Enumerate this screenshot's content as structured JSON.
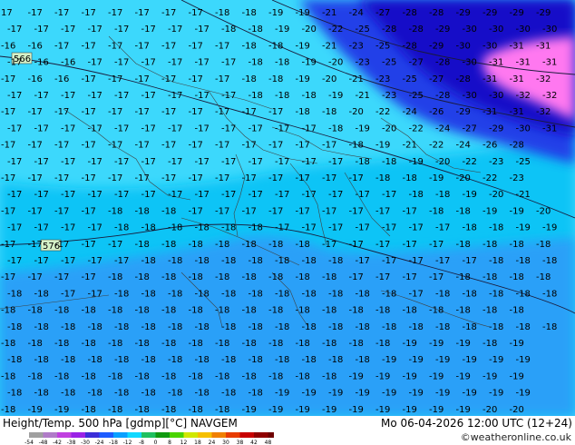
{
  "footer": {
    "title_left": "Height/Temp. 500 hPa [gdmp][°C] NAVGEM",
    "title_right": "Mo 06-04-2026 12:00 UTC (12+24)",
    "credit": "©weatheronline.co.uk"
  },
  "colorbar": {
    "ticks": [
      "-54",
      "-48",
      "-42",
      "-38",
      "-30",
      "-24",
      "-18",
      "-12",
      "-8",
      "0",
      "8",
      "12",
      "18",
      "24",
      "30",
      "38",
      "42",
      "48",
      "54"
    ],
    "colors": [
      "#a0a0a0",
      "#b07cc8",
      "#c040e0",
      "#9a22e6",
      "#3c2ed8",
      "#1e5cff",
      "#0aa0ff",
      "#10d8ff",
      "#20c060",
      "#109a10",
      "#4ad400",
      "#d0e800",
      "#f6c000",
      "#f08000",
      "#e83c00",
      "#c80000",
      "#900000",
      "#6e0000"
    ]
  },
  "map": {
    "colors": {
      "cyan_light": "#3cd8fc",
      "cyan": "#0fc4f6",
      "blue_mid": "#2aa0f8",
      "blue": "#1e78f0",
      "blue_dark": "#2040e8",
      "indigo": "#1510c8",
      "magenta": "#ff78f0"
    },
    "contour_labels": [
      "566",
      "576"
    ],
    "temperature_rows": [
      [
        "17",
        "-17",
        "-17",
        "-17",
        "-17",
        "-17",
        "-17",
        "-17",
        "-18",
        "-18",
        "-19",
        "-19",
        "-21",
        "-24",
        "-27",
        "-28",
        "-28",
        "-29",
        "-29",
        "-29",
        "-29",
        "-29"
      ],
      [
        "-17",
        "-17",
        "-17",
        "-17",
        "-17",
        "-17",
        "-17",
        "-17",
        "-18",
        "-18",
        "-19",
        "-20",
        "-22",
        "-25",
        "-28",
        "-28",
        "-29",
        "-30",
        "-30",
        "-30",
        "-30"
      ],
      [
        "-16",
        "-16",
        "-17",
        "-17",
        "-17",
        "-17",
        "-17",
        "-17",
        "-17",
        "-18",
        "-18",
        "-19",
        "-21",
        "-23",
        "-25",
        "-28",
        "-29",
        "-30",
        "-30",
        "-31",
        "-31",
        "-30"
      ],
      [
        "-17",
        "-16",
        "-16",
        "-17",
        "-17",
        "-17",
        "-17",
        "-17",
        "-17",
        "-18",
        "-18",
        "-19",
        "-20",
        "-23",
        "-25",
        "-27",
        "-28",
        "-30",
        "-31",
        "-31",
        "-31",
        "-31"
      ],
      [
        "-17",
        "-16",
        "-16",
        "-17",
        "-17",
        "-17",
        "-17",
        "-17",
        "-17",
        "-18",
        "-18",
        "-19",
        "-20",
        "-21",
        "-23",
        "-25",
        "-27",
        "-28",
        "-31",
        "-31",
        "-32",
        "-32"
      ],
      [
        "-17",
        "-17",
        "-17",
        "-17",
        "-17",
        "-17",
        "-17",
        "-17",
        "-17",
        "-18",
        "-18",
        "-18",
        "-19",
        "-21",
        "-23",
        "-25",
        "-28",
        "-30",
        "-30",
        "-32",
        "-32",
        "-32"
      ],
      [
        "-17",
        "-17",
        "-17",
        "-17",
        "-17",
        "-17",
        "-17",
        "-17",
        "-17",
        "-17",
        "-17",
        "-18",
        "-18",
        "-20",
        "-22",
        "-24",
        "-26",
        "-29",
        "-31",
        "-31",
        "-32"
      ],
      [
        "-17",
        "-17",
        "-17",
        "-17",
        "-17",
        "-17",
        "-17",
        "-17",
        "-17",
        "-17",
        "-17",
        "-17",
        "-18",
        "-19",
        "-20",
        "-22",
        "-24",
        "-27",
        "-29",
        "-30",
        "-31"
      ],
      [
        "-17",
        "-17",
        "-17",
        "-17",
        "-17",
        "-17",
        "-17",
        "-17",
        "-17",
        "-17",
        "-17",
        "-17",
        "-17",
        "-18",
        "-19",
        "-21",
        "-22",
        "-24",
        "-26",
        "-28"
      ],
      [
        "-17",
        "-17",
        "-17",
        "-17",
        "-17",
        "-17",
        "-17",
        "-17",
        "-17",
        "-17",
        "-17",
        "-17",
        "-17",
        "-18",
        "-18",
        "-19",
        "-20",
        "-22",
        "-23",
        "-25"
      ],
      [
        "-17",
        "-17",
        "-17",
        "-17",
        "-17",
        "-17",
        "-17",
        "-17",
        "-17",
        "-17",
        "-17",
        "-17",
        "-17",
        "-17",
        "-18",
        "-18",
        "-19",
        "-20",
        "-22",
        "-23"
      ],
      [
        "-17",
        "-17",
        "-17",
        "-17",
        "-17",
        "-17",
        "-17",
        "-17",
        "-17",
        "-17",
        "-17",
        "-17",
        "-17",
        "-17",
        "-17",
        "-18",
        "-18",
        "-19",
        "-20",
        "-21"
      ],
      [
        "-17",
        "-17",
        "-17",
        "-17",
        "-18",
        "-18",
        "-18",
        "-17",
        "-17",
        "-17",
        "-17",
        "-17",
        "-17",
        "-17",
        "-17",
        "-17",
        "-18",
        "-18",
        "-19",
        "-19",
        "-20"
      ],
      [
        "-17",
        "-17",
        "-17",
        "-17",
        "-18",
        "-18",
        "-18",
        "-18",
        "-18",
        "-18",
        "-17",
        "-17",
        "-17",
        "-17",
        "-17",
        "-17",
        "-17",
        "-18",
        "-18",
        "-19",
        "-19"
      ],
      [
        "-17",
        "-17",
        "-17",
        "-17",
        "-17",
        "-18",
        "-18",
        "-18",
        "-18",
        "-18",
        "-18",
        "-18",
        "-17",
        "-17",
        "-17",
        "-17",
        "-17",
        "-18",
        "-18",
        "-18",
        "-18"
      ],
      [
        "-17",
        "-17",
        "-17",
        "-17",
        "-17",
        "-18",
        "-18",
        "-18",
        "-18",
        "-18",
        "-18",
        "-18",
        "-18",
        "-17",
        "-17",
        "-17",
        "-17",
        "-17",
        "-18",
        "-18",
        "-18"
      ],
      [
        "-17",
        "-17",
        "-17",
        "-17",
        "-18",
        "-18",
        "-18",
        "-18",
        "-18",
        "-18",
        "-18",
        "-18",
        "-18",
        "-17",
        "-17",
        "-17",
        "-17",
        "-18",
        "-18",
        "-18",
        "-18"
      ],
      [
        "-18",
        "-18",
        "-17",
        "-17",
        "-18",
        "-18",
        "-18",
        "-18",
        "-18",
        "-18",
        "-18",
        "-18",
        "-18",
        "-18",
        "-18",
        "-17",
        "-18",
        "-18",
        "-18",
        "-18",
        "-18"
      ],
      [
        "-18",
        "-18",
        "-18",
        "-18",
        "-18",
        "-18",
        "-18",
        "-18",
        "-18",
        "-18",
        "-18",
        "-18",
        "-18",
        "-18",
        "-18",
        "-18",
        "-18",
        "-18",
        "-18",
        "-18"
      ],
      [
        "-18",
        "-18",
        "-18",
        "-18",
        "-18",
        "-18",
        "-18",
        "-18",
        "-18",
        "-18",
        "-18",
        "-18",
        "-18",
        "-18",
        "-18",
        "-18",
        "-18",
        "-18",
        "-18",
        "-18",
        "-18"
      ],
      [
        "-18",
        "-18",
        "-18",
        "-18",
        "-18",
        "-18",
        "-18",
        "-18",
        "-18",
        "-18",
        "-18",
        "-18",
        "-18",
        "-18",
        "-18",
        "-19",
        "-19",
        "-19",
        "-18",
        "-19"
      ],
      [
        "-18",
        "-18",
        "-18",
        "-18",
        "-18",
        "-18",
        "-18",
        "-18",
        "-18",
        "-18",
        "-18",
        "-18",
        "-18",
        "-18",
        "-19",
        "-19",
        "-19",
        "-19",
        "-19",
        "-19"
      ],
      [
        "-18",
        "-18",
        "-18",
        "-18",
        "-18",
        "-18",
        "-18",
        "-18",
        "-18",
        "-18",
        "-18",
        "-18",
        "-18",
        "-19",
        "-19",
        "-19",
        "-19",
        "-19",
        "-19",
        "-19"
      ],
      [
        "-18",
        "-18",
        "-18",
        "-18",
        "-18",
        "-18",
        "-18",
        "-18",
        "-18",
        "-18",
        "-19",
        "-19",
        "-19",
        "-19",
        "-19",
        "-19",
        "-19",
        "-19",
        "-19",
        "-19"
      ],
      [
        "-18",
        "-19",
        "-19",
        "-18",
        "-18",
        "-18",
        "-18",
        "-18",
        "-18",
        "-19",
        "-19",
        "-19",
        "-19",
        "-19",
        "-19",
        "-19",
        "-19",
        "-19",
        "-20",
        "-20"
      ],
      [
        "-19",
        "-19",
        "-19",
        "-19",
        "-18",
        "-18",
        "-19",
        "-19",
        "-19",
        "-19",
        "-19",
        "-19",
        "-19",
        "-19",
        "-19",
        "-19",
        "-19",
        "-20",
        "-20",
        "-20"
      ]
    ]
  }
}
